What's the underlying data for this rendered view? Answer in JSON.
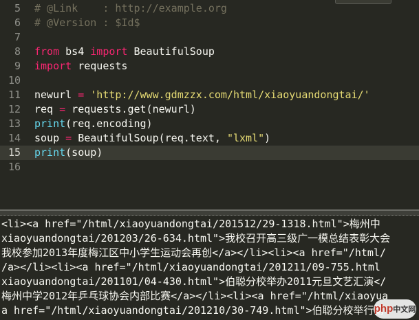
{
  "editor": {
    "lines": [
      {
        "num": "5",
        "tokens": [
          {
            "t": "comment",
            "v": "# @Link    : http://example.org"
          }
        ]
      },
      {
        "num": "6",
        "tokens": [
          {
            "t": "comment",
            "v": "# @Version : $Id$"
          }
        ]
      },
      {
        "num": "7",
        "tokens": []
      },
      {
        "num": "8",
        "tokens": [
          {
            "t": "keyword",
            "v": "from"
          },
          {
            "t": "plain",
            "v": " bs4 "
          },
          {
            "t": "keyword",
            "v": "import"
          },
          {
            "t": "plain",
            "v": " BeautifulSoup"
          }
        ]
      },
      {
        "num": "9",
        "tokens": [
          {
            "t": "keyword",
            "v": "import"
          },
          {
            "t": "plain",
            "v": " requests"
          }
        ]
      },
      {
        "num": "10",
        "tokens": []
      },
      {
        "num": "11",
        "tokens": [
          {
            "t": "plain",
            "v": "newurl "
          },
          {
            "t": "op",
            "v": "="
          },
          {
            "t": "plain",
            "v": " "
          },
          {
            "t": "string",
            "v": "'http://www.gdmzzx.com/html/xiaoyuandongtai/'"
          }
        ]
      },
      {
        "num": "12",
        "tokens": [
          {
            "t": "plain",
            "v": "req "
          },
          {
            "t": "op",
            "v": "="
          },
          {
            "t": "plain",
            "v": " requests.get(newurl)"
          }
        ]
      },
      {
        "num": "13",
        "tokens": [
          {
            "t": "builtin",
            "v": "print"
          },
          {
            "t": "plain",
            "v": "(req.encoding)"
          }
        ]
      },
      {
        "num": "14",
        "tokens": [
          {
            "t": "plain",
            "v": "soup "
          },
          {
            "t": "op",
            "v": "="
          },
          {
            "t": "plain",
            "v": " BeautifulSoup(req.text, "
          },
          {
            "t": "string",
            "v": "\"lxml\""
          },
          {
            "t": "plain",
            "v": ")"
          }
        ]
      },
      {
        "num": "15",
        "active": true,
        "tokens": [
          {
            "t": "builtin",
            "v": "print"
          },
          {
            "t": "plain",
            "v": "(soup)"
          }
        ]
      },
      {
        "num": "16",
        "tokens": []
      }
    ]
  },
  "console": {
    "lines": [
      "<li><a href=\"/html/xiaoyuandongtai/201512/29-1318.html\">梅州中",
      "xiaoyuandongtai/201203/26-634.html\">我校召开高三级广一模总结表彰大会",
      "我校参加2013年度梅江区中小学生运动会再创</a></li><li><a href=\"/html/",
      "/a></li><li><a href=\"/html/xiaoyuandongtai/201211/09-755.html",
      "xiaoyuandongtai/201101/04-430.html\">伯聪分校举办2011元旦文艺汇演</",
      "梅州中学2012年乒乓球协会内部比赛</a></li><li><a href=\"/html/xiaoyua",
      "a href=\"/html/xiaoyuandongtai/201210/30-749.html\">伯聪分校举行第"
    ]
  },
  "watermark": {
    "a": "php",
    "b": "中文网"
  }
}
